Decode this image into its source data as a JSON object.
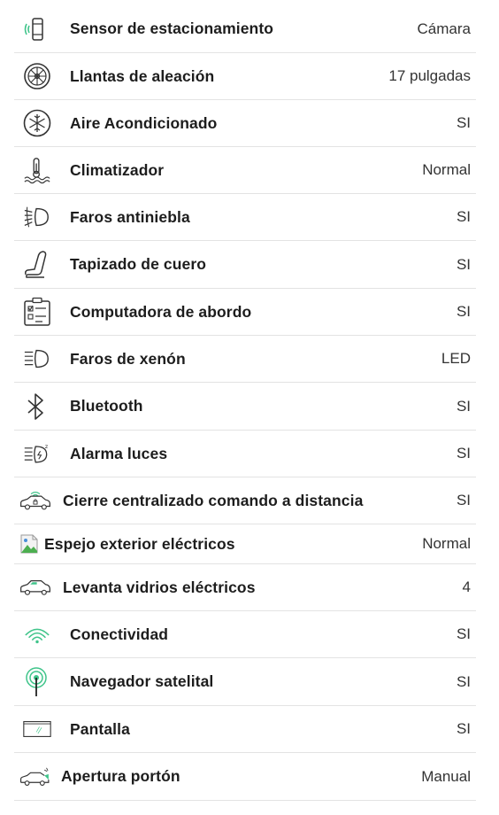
{
  "features": [
    {
      "icon": "parking-sensor-icon",
      "label": "Sensor de estacionamiento",
      "value": "Cámara"
    },
    {
      "icon": "alloy-wheel-icon",
      "label": "Llantas de aleación",
      "value": "17 pulgadas"
    },
    {
      "icon": "snowflake-icon",
      "label": "Aire Acondicionado",
      "value": "SI"
    },
    {
      "icon": "thermometer-icon",
      "label": "Climatizador",
      "value": "Normal"
    },
    {
      "icon": "fog-light-icon",
      "label": "Faros antiniebla",
      "value": "SI"
    },
    {
      "icon": "seat-icon",
      "label": "Tapizado de cuero",
      "value": "SI"
    },
    {
      "icon": "checklist-icon",
      "label": "Computadora de abordo",
      "value": "SI"
    },
    {
      "icon": "headlight-icon",
      "label": "Faros de xenón",
      "value": "LED"
    },
    {
      "icon": "bluetooth-icon",
      "label": "Bluetooth",
      "value": "SI"
    },
    {
      "icon": "light-alarm-icon",
      "label": "Alarma luces",
      "value": "SI"
    },
    {
      "icon": "remote-lock-car-icon",
      "label": "Cierre centralizado comando a distancia",
      "value": "SI"
    },
    {
      "icon": "broken-image-icon",
      "label": "Espejo exterior eléctricos",
      "value": "Normal"
    },
    {
      "icon": "car-window-icon",
      "label": "Levanta vidrios eléctricos",
      "value": "4"
    },
    {
      "icon": "wifi-signal-icon",
      "label": "Conectividad",
      "value": "SI"
    },
    {
      "icon": "gps-antenna-icon",
      "label": "Navegador satelital",
      "value": "SI"
    },
    {
      "icon": "screen-icon",
      "label": "Pantalla",
      "value": "SI"
    },
    {
      "icon": "car-trunk-icon",
      "label": "Apertura portón",
      "value": "Manual"
    }
  ],
  "colors": {
    "accent": "#3fc48a",
    "icon_stroke": "#333333",
    "divider": "#e3e3e3"
  }
}
